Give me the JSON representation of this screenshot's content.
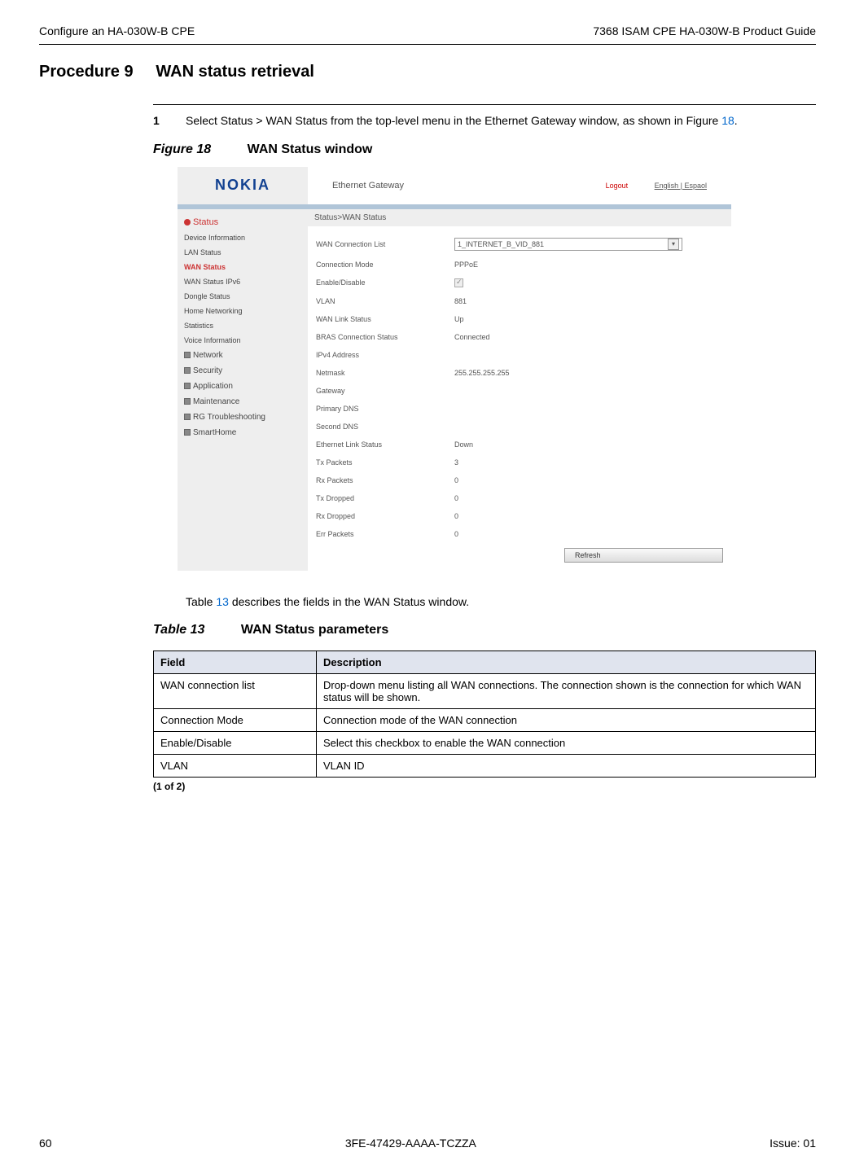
{
  "header": {
    "left": "Configure an HA-030W-B CPE",
    "right": "7368 ISAM CPE HA-030W-B Product Guide"
  },
  "procedure": {
    "label": "Procedure 9",
    "title": "WAN status retrieval"
  },
  "step": {
    "num": "1",
    "text_before": "Select Status > WAN Status from the top-level menu in the Ethernet Gateway window, as shown in Figure ",
    "ref": "18",
    "text_after": "."
  },
  "figure": {
    "label": "Figure 18",
    "title": "WAN Status window"
  },
  "screenshot": {
    "logo": "NOKIA",
    "title": "Ethernet Gateway",
    "logout": "Logout",
    "lang": "English | Espaol",
    "breadcrumb": "Status>WAN Status",
    "sidebar": {
      "status": "Status",
      "items1": [
        "Device Information",
        "LAN Status"
      ],
      "wan_status": "WAN Status",
      "items2": [
        "WAN Status IPv6",
        "Dongle Status",
        "Home Networking",
        "Statistics",
        "Voice Information"
      ],
      "cats": [
        "Network",
        "Security",
        "Application",
        "Maintenance",
        "RG Troubleshooting",
        "SmartHome"
      ]
    },
    "dropdown_label": "WAN Connection List",
    "dropdown_value": "1_INTERNET_B_VID_881",
    "rows": [
      {
        "label": "Connection Mode",
        "value": "PPPoE"
      },
      {
        "label": "Enable/Disable",
        "value": "",
        "checkbox": true
      },
      {
        "label": "VLAN",
        "value": "881"
      },
      {
        "label": "WAN Link Status",
        "value": "Up"
      },
      {
        "label": "BRAS Connection Status",
        "value": "Connected"
      },
      {
        "label": "IPv4 Address",
        "value": ""
      },
      {
        "label": "Netmask",
        "value": "255.255.255.255"
      },
      {
        "label": "Gateway",
        "value": ""
      },
      {
        "label": "Primary DNS",
        "value": ""
      },
      {
        "label": "Second DNS",
        "value": ""
      },
      {
        "label": "Ethernet Link Status",
        "value": "Down"
      },
      {
        "label": "Tx Packets",
        "value": "3"
      },
      {
        "label": "Rx Packets",
        "value": "0"
      },
      {
        "label": "Tx Dropped",
        "value": "0"
      },
      {
        "label": "Rx Dropped",
        "value": "0"
      },
      {
        "label": "Err Packets",
        "value": "0"
      }
    ],
    "refresh": "Refresh"
  },
  "table_desc": {
    "before": "Table ",
    "ref": "13",
    "after": " describes the fields in the WAN Status window."
  },
  "table_heading": {
    "label": "Table 13",
    "title": "WAN Status parameters"
  },
  "table": {
    "header_field": "Field",
    "header_desc": "Description",
    "rows": [
      {
        "field": "WAN connection list",
        "desc": "Drop-down menu listing all WAN connections. The connection shown is the connection for which WAN status will be shown."
      },
      {
        "field": "Connection Mode",
        "desc": "Connection mode of the WAN connection"
      },
      {
        "field": "Enable/Disable",
        "desc": "Select this checkbox to enable the WAN connection"
      },
      {
        "field": "VLAN",
        "desc": "VLAN ID"
      }
    ],
    "caption": "(1 of 2)"
  },
  "footer": {
    "page": "60",
    "doc": "3FE-47429-AAAA-TCZZA",
    "issue": "Issue: 01"
  }
}
